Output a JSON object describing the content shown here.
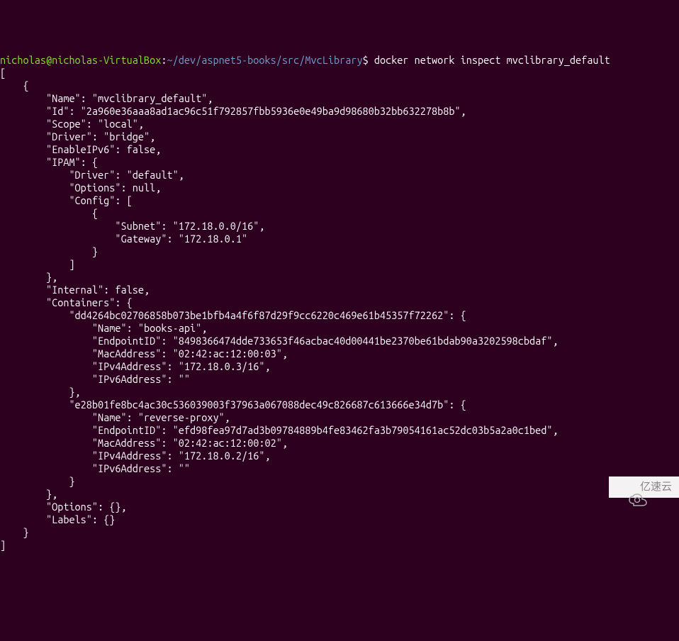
{
  "prompt": {
    "user": "nicholas@nicholas-VirtualBox",
    "colon": ":",
    "path": "~/dev/aspnet5-books/src/MvcLibrary",
    "dollar": "$"
  },
  "command": "docker network inspect mvclibrary_default",
  "output": "[\n    {\n        \"Name\": \"mvclibrary_default\",\n        \"Id\": \"2a960e36aaa8ad1ac96c51f792857fbb5936e0e49ba9d98680b32bb632278b8b\",\n        \"Scope\": \"local\",\n        \"Driver\": \"bridge\",\n        \"EnableIPv6\": false,\n        \"IPAM\": {\n            \"Driver\": \"default\",\n            \"Options\": null,\n            \"Config\": [\n                {\n                    \"Subnet\": \"172.18.0.0/16\",\n                    \"Gateway\": \"172.18.0.1\"\n                }\n            ]\n        },\n        \"Internal\": false,\n        \"Containers\": {\n            \"dd4264bc02706858b073be1bfb4a4f6f87d29f9cc6220c469e61b45357f72262\": {\n                \"Name\": \"books-api\",\n                \"EndpointID\": \"8498366474dde733653f46acbac40d00441be2370be61bdab90a3202598cbdaf\",\n                \"MacAddress\": \"02:42:ac:12:00:03\",\n                \"IPv4Address\": \"172.18.0.3/16\",\n                \"IPv6Address\": \"\"\n            },\n            \"e28b01fe8bc4ac30c536039003f37963a067088dec49c826687c613666e34d7b\": {\n                \"Name\": \"reverse-proxy\",\n                \"EndpointID\": \"efd98fea97d7ad3b09784889b4fe83462fa3b79054161ac52dc03b5a2a0c1bed\",\n                \"MacAddress\": \"02:42:ac:12:00:02\",\n                \"IPv4Address\": \"172.18.0.2/16\",\n                \"IPv6Address\": \"\"\n            }\n        },\n        \"Options\": {},\n        \"Labels\": {}\n    }\n]",
  "watermark": {
    "text": "亿速云"
  }
}
